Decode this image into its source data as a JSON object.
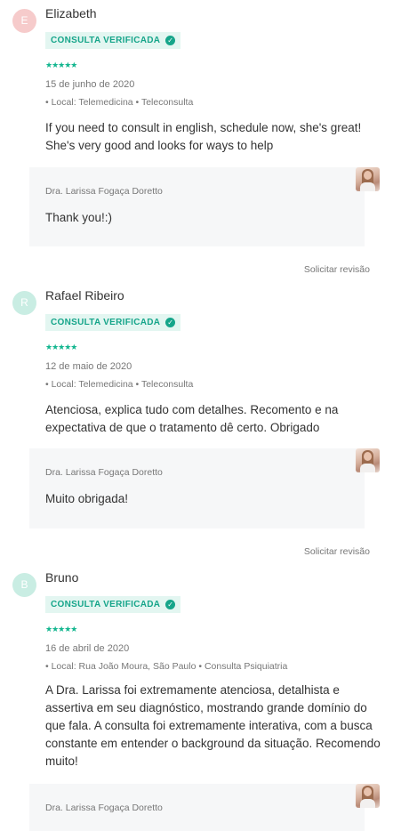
{
  "badge_label": "CONSULTA VERIFICADA",
  "stars": "★★★★★",
  "revision_label": "Solicitar revisão",
  "colors": {
    "accent": "#13b68f",
    "badge_bg": "#e3f6f1",
    "reply_bg": "#f6f7f8"
  },
  "reviews": [
    {
      "initial": "E",
      "avatar_color": "#f6cbcb",
      "name": "Elizabeth",
      "date": "15 de junho de 2020",
      "meta": "• Local: Telemedicina • Teleconsulta",
      "text_lines": [
        "If you need to consult in english, schedule now, she's great!",
        "She's very good and looks for ways to help"
      ],
      "reply": {
        "doctor": "Dra. Larissa Fogaça Doretto",
        "text": "Thank you!:)"
      }
    },
    {
      "initial": "R",
      "avatar_color": "#c9ede3",
      "name": "Rafael Ribeiro",
      "date": "12 de maio de 2020",
      "meta": "• Local: Telemedicina • Teleconsulta",
      "text_lines": [
        "Atenciosa, explica tudo com detalhes. Recomento e na",
        "expectativa de que o tratamento dê certo. Obrigado"
      ],
      "reply": {
        "doctor": "Dra. Larissa Fogaça Doretto",
        "text": "Muito obrigada!"
      }
    },
    {
      "initial": "B",
      "avatar_color": "#c9ede3",
      "name": "Bruno",
      "date": "16 de abril de 2020",
      "meta": "• Local: Rua João Moura, São Paulo • Consulta Psiquiatria",
      "text_lines": [
        "A Dra. Larissa foi extremamente atenciosa, detalhista e",
        "assertiva em seu diagnóstico, mostrando grande domínio do",
        "que fala. A consulta foi extremamente interativa, com a busca",
        "constante em entender o background da situação. Recomendo",
        "muito!"
      ],
      "reply": {
        "doctor": "Dra. Larissa Fogaça Doretto",
        "text": ""
      }
    }
  ]
}
